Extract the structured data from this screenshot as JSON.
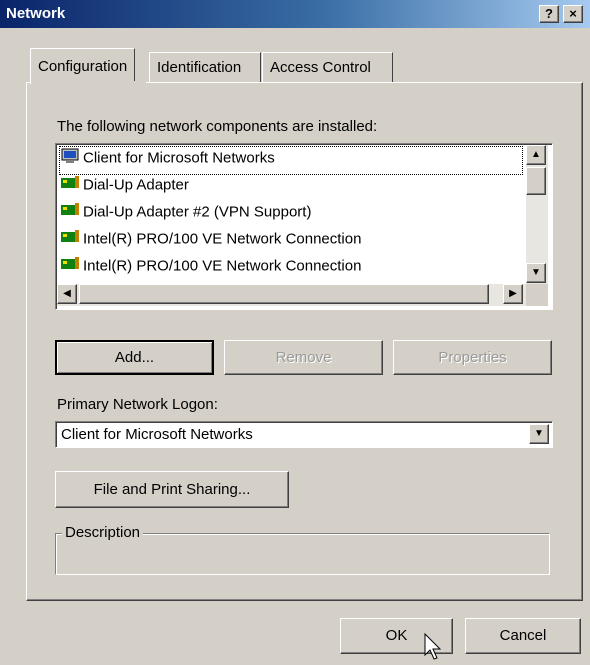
{
  "window": {
    "title": "Network",
    "help_button": "?",
    "close_button": "×"
  },
  "tabs": [
    {
      "label": "Configuration"
    },
    {
      "label": "Identification"
    },
    {
      "label": "Access Control"
    }
  ],
  "components": {
    "label": "The following network components are installed:",
    "items": [
      {
        "label": "Client for Microsoft Networks",
        "icon": "client-icon"
      },
      {
        "label": "Dial-Up Adapter",
        "icon": "network-adapter-icon"
      },
      {
        "label": "Dial-Up Adapter #2 (VPN Support)",
        "icon": "network-adapter-icon"
      },
      {
        "label": "Intel(R) PRO/100 VE Network Connection",
        "icon": "network-adapter-icon"
      },
      {
        "label": "Intel(R) PRO/100 VE Network Connection",
        "icon": "network-adapter-icon"
      }
    ]
  },
  "buttons": {
    "add": "Add...",
    "remove": "Remove",
    "properties": "Properties",
    "file_print_sharing": "File and Print Sharing...",
    "ok": "OK",
    "cancel": "Cancel"
  },
  "logon": {
    "label": "Primary Network Logon:",
    "value": "Client for Microsoft Networks"
  },
  "description": {
    "label": "Description",
    "text": ""
  },
  "colors": {
    "titlebar_start": "#0a246a",
    "titlebar_end": "#a6caf0",
    "face": "#d4d0c8"
  }
}
